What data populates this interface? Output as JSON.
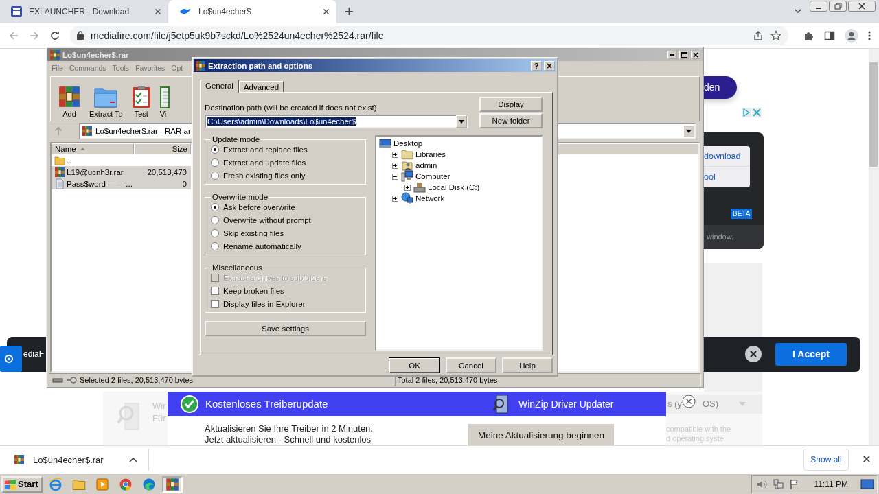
{
  "browser": {
    "tabs": [
      {
        "title": "EXLAUNCHER - Download",
        "kind": "page",
        "selected": false
      },
      {
        "title": "Lo$un4echer$",
        "kind": "bird",
        "selected": true
      }
    ],
    "new_tab": "+",
    "url": "mediafire.com/file/j5etp5uk9b7sckd/Lo%2524un4echer%2524.rar/file"
  },
  "page": {
    "ad_button": "den",
    "links": [
      "download",
      "ool"
    ],
    "badge": "BETA",
    "note": "window.",
    "cookie_text": "ediaF",
    "cookie_accept": "I Accept",
    "faded_texts": [
      "Wir",
      "Für"
    ],
    "dropdown": [
      "s (y",
      "OS)"
    ],
    "faded_lines": [
      "compatible with the",
      "d operating syste"
    ]
  },
  "ad": {
    "title": "Kostenloses Treiberupdate",
    "brand": "WinZip Driver Updater",
    "lines": [
      "Aktualisieren Sie Ihre Treiber in 2 Minuten.",
      "Jetzt aktualisieren - Schnell und kostenlos"
    ],
    "button": "Meine Aktualisierung beginnen"
  },
  "winrar": {
    "title": "Lo$un4echer$.rar",
    "menu": [
      "File",
      "Commands",
      "Tools",
      "Favorites",
      "Opt"
    ],
    "tools": [
      {
        "label": "Add",
        "kind": "archive"
      },
      {
        "label": "Extract To",
        "kind": "folder"
      },
      {
        "label": "Test",
        "kind": "clipboard"
      },
      {
        "label": "Vi",
        "kind": "book"
      }
    ],
    "path": "Lo$un4echer$.rar - RAR ar",
    "columns": [
      "Name",
      "Size"
    ],
    "rows": [
      {
        "name": "..",
        "kind": "parent",
        "selected": false
      },
      {
        "name": "L19@ucnh3r.rar",
        "size": "20,513,470",
        "kind": "archive",
        "selected": true
      },
      {
        "name": "Pass$word —— ...",
        "size": "0",
        "kind": "file",
        "selected": true
      }
    ],
    "status_left": "Selected 2 files, 20,513,470 bytes",
    "status_right": "Total 2 files, 20,513,470 bytes"
  },
  "dialog": {
    "title": "Extraction path and options",
    "help": "?",
    "tabs": [
      {
        "label": "General",
        "selected": true
      },
      {
        "label": "Advanced",
        "selected": false
      }
    ],
    "dest_label": "Destination path (will be created if does not exist)",
    "dest_value": "C:\\Users\\admin\\Downloads\\Lo$un4echer$",
    "side_buttons": [
      "Display",
      "New folder"
    ],
    "groups": [
      {
        "title": "Update mode",
        "options": [
          {
            "kind": "radio",
            "label": "Extract and replace files",
            "selected": true
          },
          {
            "kind": "radio",
            "label": "Extract and update files",
            "selected": false
          },
          {
            "kind": "radio",
            "label": "Fresh existing files only",
            "selected": false
          }
        ]
      },
      {
        "title": "Overwrite mode",
        "options": [
          {
            "kind": "radio",
            "label": "Ask before overwrite",
            "selected": true
          },
          {
            "kind": "radio",
            "label": "Overwrite without prompt",
            "selected": false
          },
          {
            "kind": "radio",
            "label": "Skip existing files",
            "selected": false
          },
          {
            "kind": "radio",
            "label": "Rename automatically",
            "selected": false
          }
        ]
      },
      {
        "title": "Miscellaneous",
        "options": [
          {
            "kind": "checkbox",
            "label": "Extract archives to subfolders",
            "checked": false,
            "disabled": true
          },
          {
            "kind": "checkbox",
            "label": "Keep broken files",
            "checked": false,
            "disabled": false
          },
          {
            "kind": "checkbox",
            "label": "Display files in Explorer",
            "checked": false,
            "disabled": false
          }
        ]
      }
    ],
    "save": "Save settings",
    "tree": [
      {
        "label": "Desktop",
        "kind": "desktop",
        "children": [
          {
            "label": "Libraries",
            "kind": "libraries",
            "expanded": false
          },
          {
            "label": "admin",
            "kind": "user",
            "expanded": false
          },
          {
            "label": "Computer",
            "kind": "computer",
            "expanded": true,
            "children": [
              {
                "label": "Local Disk (C:)",
                "kind": "disk",
                "expanded": false
              }
            ]
          },
          {
            "label": "Network",
            "kind": "network",
            "expanded": false
          }
        ]
      }
    ],
    "footer": [
      {
        "label": "OK",
        "default": true
      },
      {
        "label": "Cancel",
        "default": false
      },
      {
        "label": "Help",
        "default": false
      }
    ]
  },
  "shelf": {
    "file": "Lo$un4echer$.rar",
    "show_all": "Show all"
  },
  "taskbar": {
    "start": "Start",
    "clock": "11:11 PM",
    "apps": [
      {
        "kind": "ie",
        "selected": false
      },
      {
        "kind": "folder",
        "selected": false
      },
      {
        "kind": "media",
        "selected": false
      },
      {
        "kind": "chrome",
        "selected": false
      },
      {
        "kind": "edge",
        "selected": false
      },
      {
        "kind": "winrar",
        "selected": true
      }
    ]
  }
}
